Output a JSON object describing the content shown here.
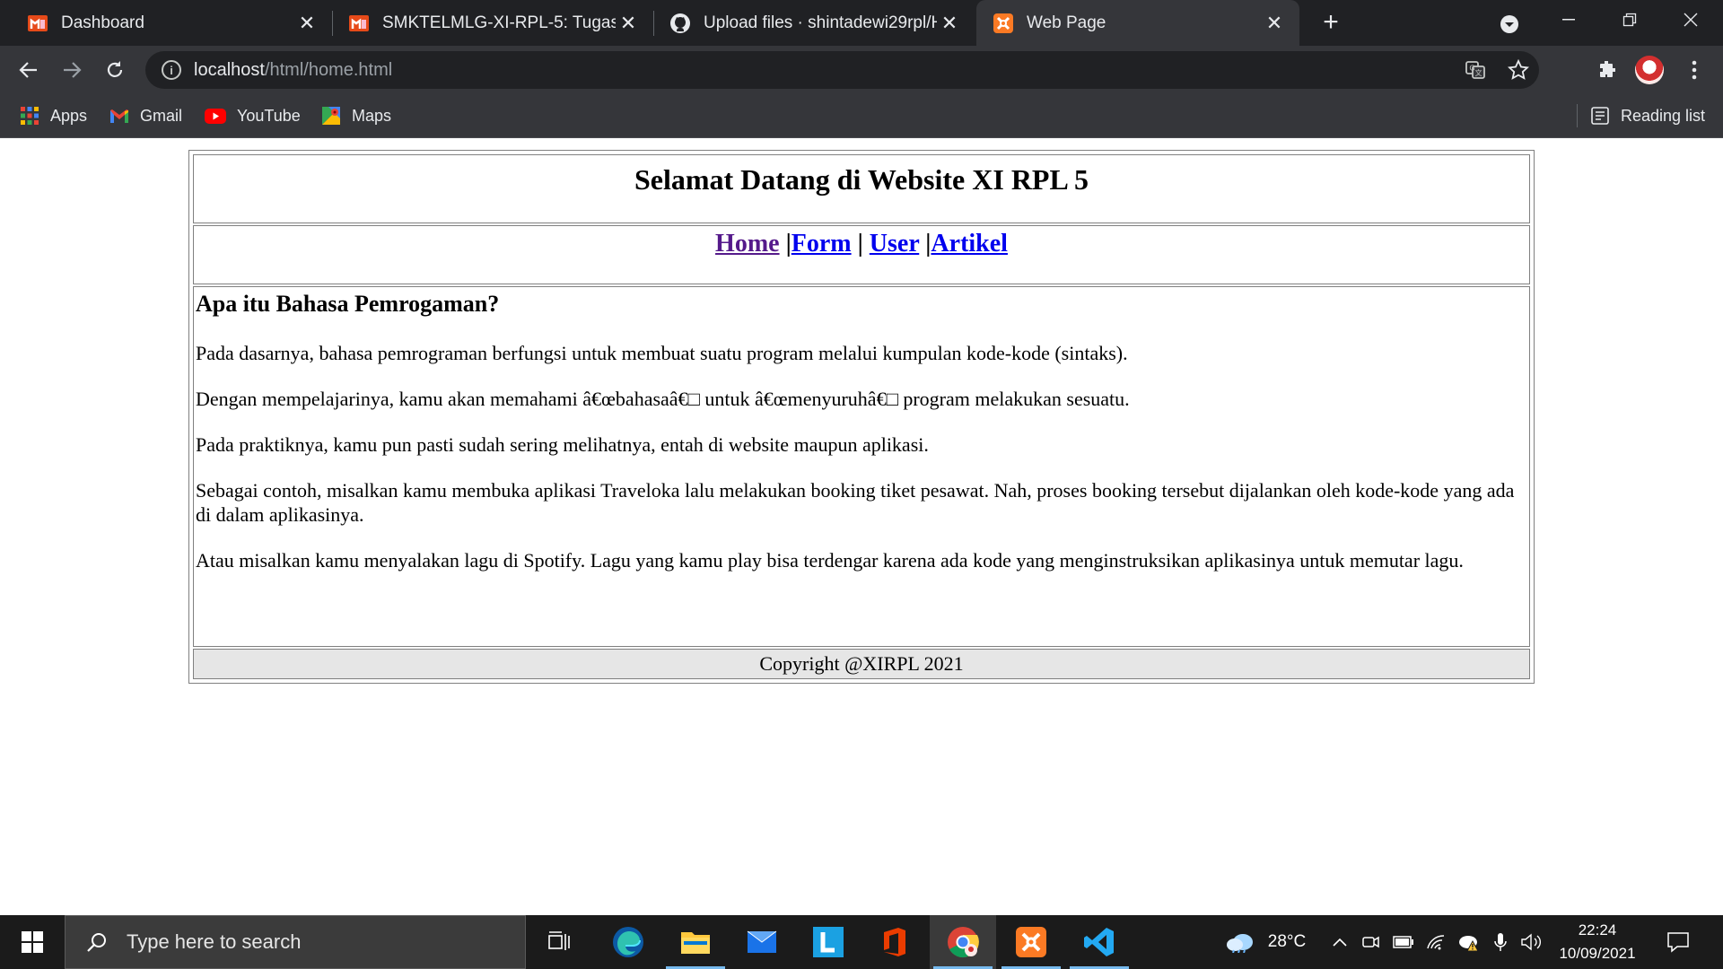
{
  "browser": {
    "tabs": [
      {
        "title": "Dashboard",
        "icon": "moodle-icon",
        "active": false
      },
      {
        "title": "SMKTELMLG-XI-RPL-5: Tugas Lay",
        "icon": "moodle-icon",
        "active": false
      },
      {
        "title": "Upload files · shintadewi29rpl/HT",
        "icon": "github-icon",
        "active": false
      },
      {
        "title": "Web Page",
        "icon": "xampp-icon",
        "active": true
      }
    ],
    "url_host": "localhost",
    "url_path": "/html/home.html",
    "bookmarks": [
      {
        "label": "Apps",
        "icon": "apps-grid-icon"
      },
      {
        "label": "Gmail",
        "icon": "gmail-icon"
      },
      {
        "label": "YouTube",
        "icon": "youtube-icon"
      },
      {
        "label": "Maps",
        "icon": "maps-icon"
      }
    ],
    "reading_list": "Reading list",
    "accent": "#35363a"
  },
  "page": {
    "heading": "Selamat Datang di Website XI RPL 5",
    "nav": {
      "home": "Home",
      "sep1": " |",
      "form": "Form",
      "sep2": " | ",
      "user": "User",
      "sep3": " |",
      "artikel": "Artikel"
    },
    "article_title": "Apa itu Bahasa Pemrogaman?",
    "paragraphs": [
      "Pada dasarnya, bahasa pemrograman berfungsi untuk membuat suatu program melalui kumpulan kode-kode (sintaks).",
      "Dengan mempelajarinya, kamu akan memahami â€œbahasaâ€□ untuk â€œmenyuruhâ€□ program melakukan sesuatu.",
      "Pada praktiknya, kamu pun pasti sudah sering melihatnya, entah di website maupun aplikasi.",
      "Sebagai contoh, misalkan kamu membuka aplikasi Traveloka lalu melakukan booking tiket pesawat. Nah, proses booking tersebut dijalankan oleh kode-kode yang ada di dalam aplikasinya.",
      "Atau misalkan kamu menyalakan lagu di Spotify. Lagu yang kamu play bisa terdengar karena ada kode yang menginstruksikan aplikasinya untuk memutar lagu."
    ],
    "footer": "Copyright @XIRPL 2021"
  },
  "taskbar": {
    "search_placeholder": "Type here to search",
    "weather": "28°C",
    "time": "22:24",
    "date": "10/09/2021"
  }
}
